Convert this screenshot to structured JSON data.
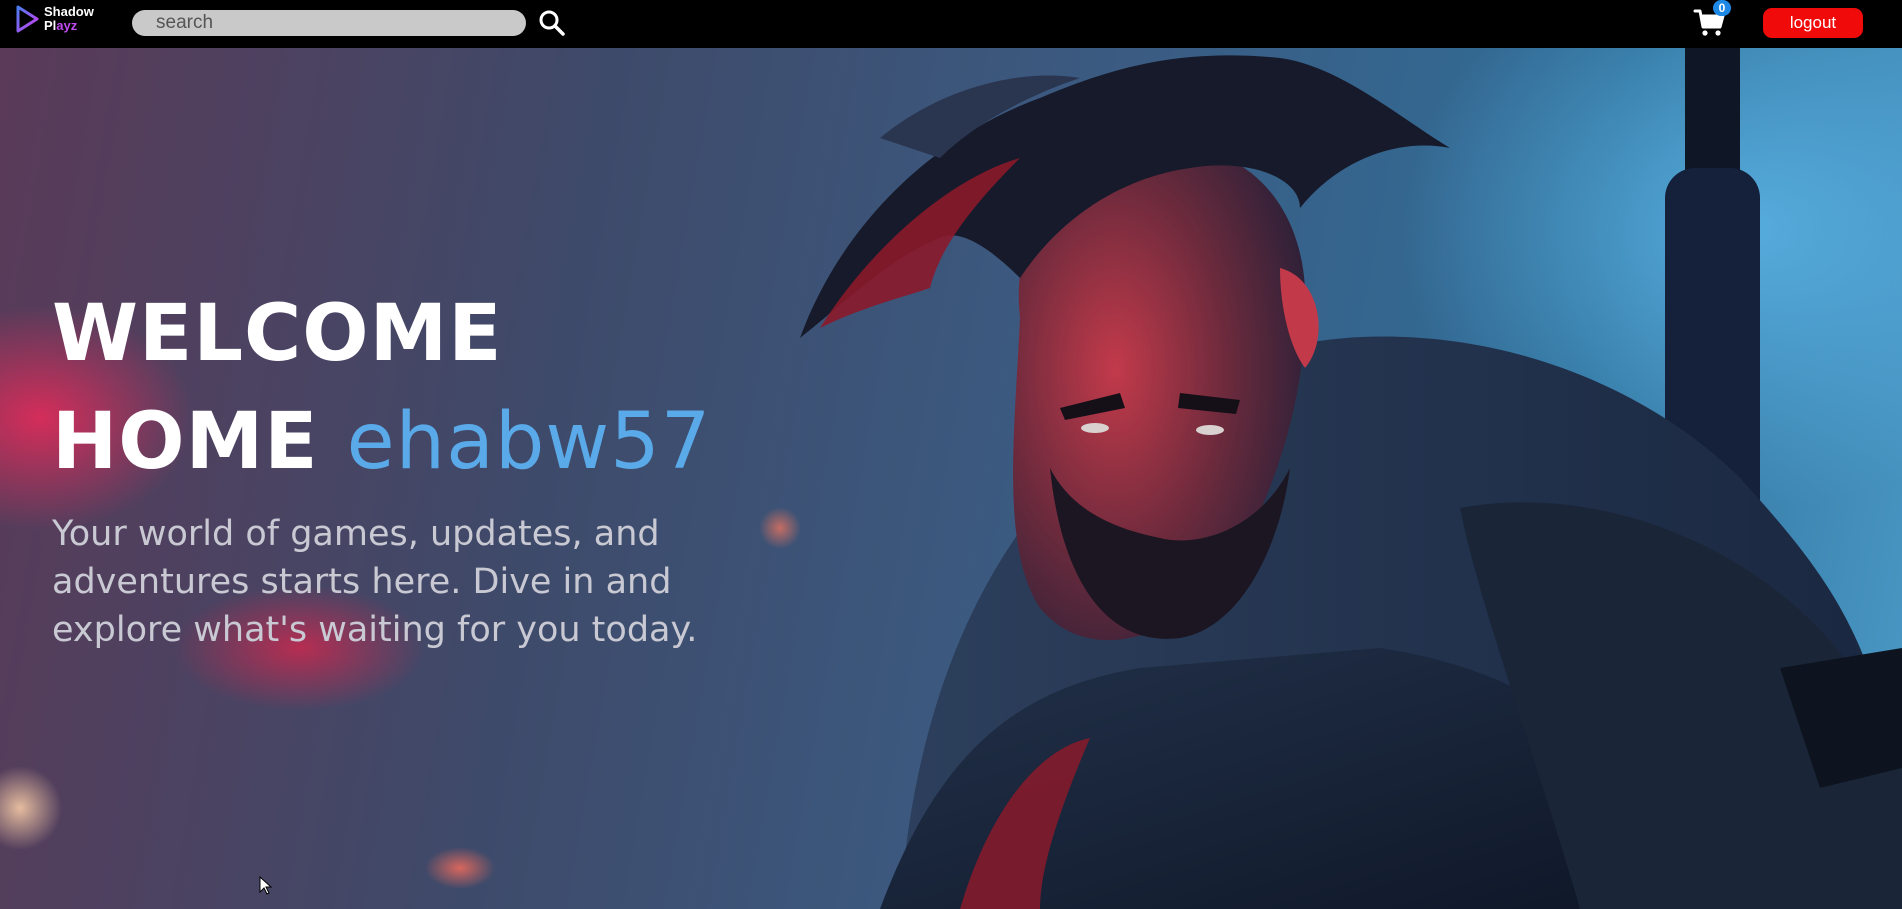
{
  "brand": {
    "name_line1": "Shadow",
    "name_line2_pre": "Pl",
    "name_line2_accent": "ayz"
  },
  "search": {
    "placeholder": "search"
  },
  "cart": {
    "count": "0"
  },
  "header": {
    "logout_label": "logout"
  },
  "hero": {
    "title_line1": "WELCOME",
    "title_line2": "HOME",
    "username": "ehabw57",
    "description": "Your world of games, updates, and adventures starts here. Dive in and explore what's waiting for you today."
  },
  "colors": {
    "accent": "#5aa9e8",
    "logout": "#f00a0a",
    "badge": "#1e88e5",
    "brand_accent": "#c04cf0"
  },
  "icons": [
    "play-logo-icon",
    "search-icon",
    "cart-icon",
    "mouse-cursor-icon"
  ]
}
